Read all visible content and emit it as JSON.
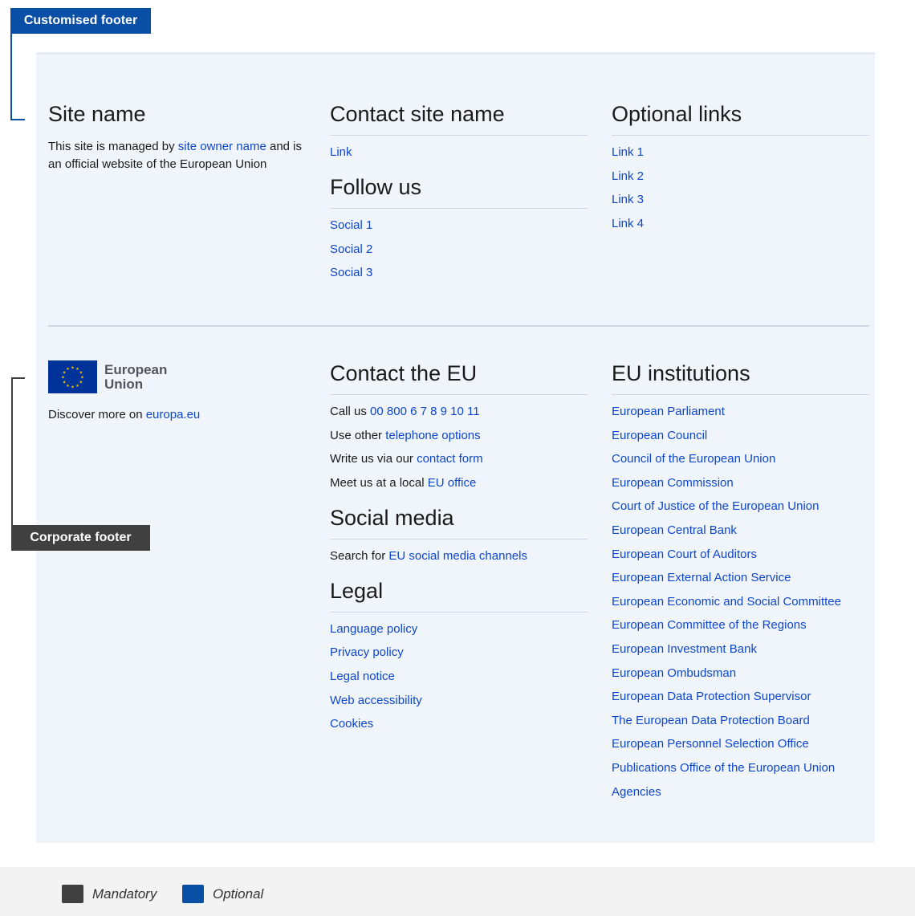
{
  "annotations": {
    "customised_label": "Customised footer",
    "corporate_label": "Corporate footer",
    "customised_color": "#0a4fa6",
    "corporate_color": "#404040"
  },
  "site": {
    "title": "Site name",
    "desc_prefix": "This site is managed by ",
    "owner_link": "site owner name",
    "desc_suffix": " and is an official website of the European Union"
  },
  "contact_site": {
    "title": "Contact site name",
    "link": "Link"
  },
  "follow": {
    "title": "Follow us",
    "links": [
      "Social 1",
      "Social 2",
      "Social 3"
    ]
  },
  "optional": {
    "title": "Optional links",
    "links": [
      "Link 1",
      "Link 2",
      "Link 3",
      "Link 4"
    ]
  },
  "eu": {
    "logo_line1": "European",
    "logo_line2": "Union",
    "discover_prefix": "Discover more on ",
    "discover_link": "europa.eu"
  },
  "contact_eu": {
    "title": "Contact the EU",
    "rows": [
      {
        "prefix": "Call us ",
        "link": "00 800 6 7 8 9 10 11"
      },
      {
        "prefix": "Use other ",
        "link": "telephone options"
      },
      {
        "prefix": "Write us via our ",
        "link": "contact form"
      },
      {
        "prefix": "Meet us at a local ",
        "link": "EU office"
      }
    ]
  },
  "social_media": {
    "title": "Social media",
    "prefix": "Search for ",
    "link": "EU social media channels"
  },
  "legal": {
    "title": "Legal",
    "links": [
      "Language policy",
      "Privacy policy",
      "Legal notice",
      "Web accessibility",
      "Cookies"
    ]
  },
  "institutions": {
    "title": "EU institutions",
    "links": [
      "European Parliament",
      "European Council",
      "Council of the European Union",
      "European Commission",
      "Court of Justice of the European Union",
      "European Central Bank",
      "European Court of Auditors",
      "European External Action Service",
      "European Economic and Social Committee",
      "European Committee of the Regions",
      "European Investment Bank",
      "European Ombudsman",
      "European Data Protection Supervisor",
      "The European Data Protection Board",
      "European Personnel Selection Office",
      "Publications Office of the European Union",
      "Agencies"
    ]
  },
  "legend": {
    "mandatory": "Mandatory",
    "optional": "Optional",
    "mandatory_color": "#404040",
    "optional_color": "#0a4fa6"
  }
}
